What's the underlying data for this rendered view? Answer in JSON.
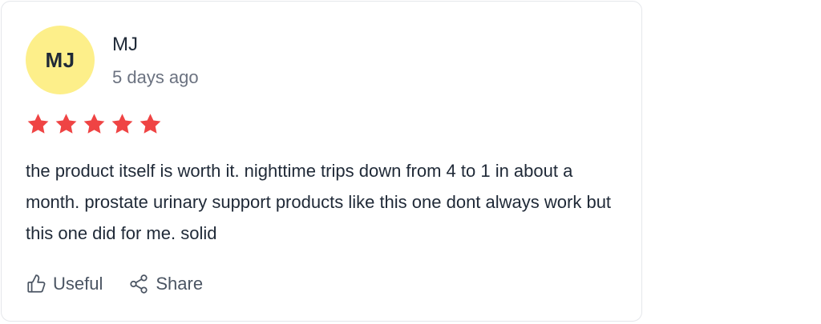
{
  "review": {
    "avatar_initials": "MJ",
    "avatar_color": "#fdef8a",
    "author": "MJ",
    "time": "5 days ago",
    "rating": 5,
    "max_rating": 5,
    "star_color": "#ef4444",
    "text": "the product itself is worth it. nighttime trips down from 4 to 1 in about a month. prostate urinary support products like this one dont always work but this one did for me. solid"
  },
  "actions": {
    "useful_label": "Useful",
    "useful_icon": "thumbs-up-icon",
    "share_label": "Share",
    "share_icon": "share-icon"
  }
}
